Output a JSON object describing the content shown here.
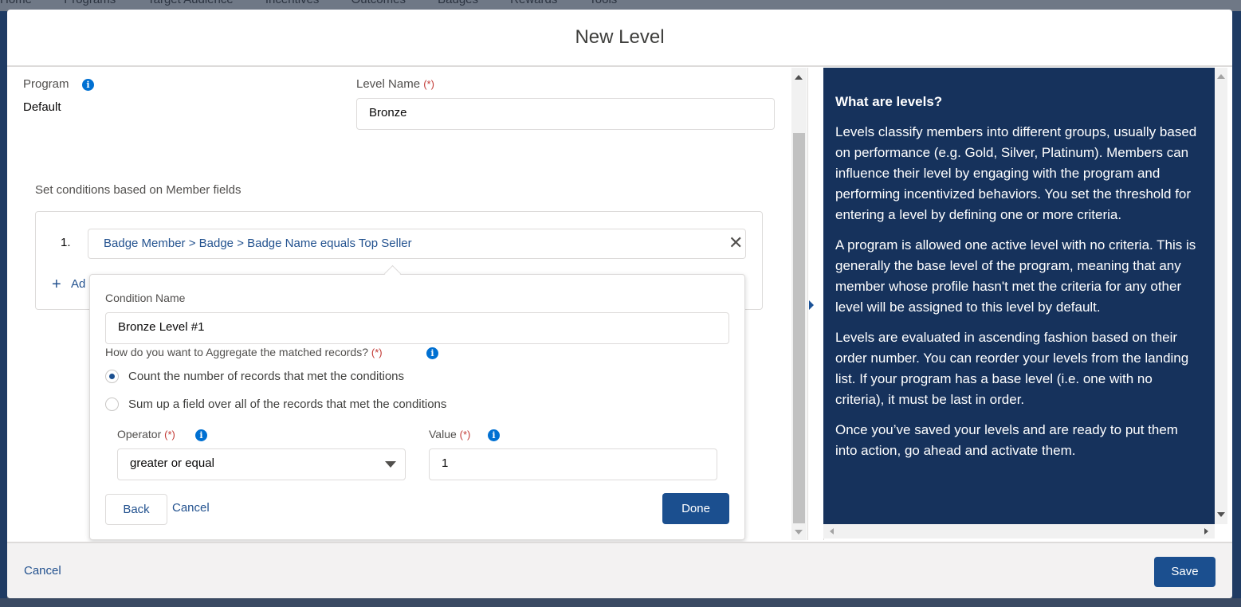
{
  "background_nav": {
    "items": [
      "Home",
      "Programs",
      "Target Audience",
      "Incentives",
      "Outcomes",
      "Badges",
      "Rewards",
      "Tools"
    ]
  },
  "modal": {
    "title": "New Level",
    "footer": {
      "cancel_label": "Cancel",
      "save_label": "Save"
    }
  },
  "program": {
    "label": "Program",
    "value": "Default"
  },
  "level_name": {
    "label": "Level Name",
    "required_marker": "(*)",
    "value": "Bronze"
  },
  "conditions": {
    "heading": "Set conditions based on Member fields",
    "items": [
      {
        "number": "1.",
        "text": "Badge Member > Badge > Badge Name equals Top Seller",
        "remove_icon": "close-icon"
      }
    ],
    "add_label": "Ad"
  },
  "popover": {
    "condition_name_label": "Condition Name",
    "condition_name_value": "Bronze Level #1",
    "aggregate_question": "How do you want to Aggregate the matched records?",
    "required_marker": "(*)",
    "options": [
      {
        "label": "Count the number of records that met the conditions",
        "selected": true
      },
      {
        "label": "Sum up a field over all of the records that met the conditions",
        "selected": false
      }
    ],
    "operator_label": "Operator",
    "operator_value": "greater or equal",
    "value_label": "Value",
    "value_value": "1",
    "back_label": "Back",
    "cancel_label": "Cancel",
    "done_label": "Done"
  },
  "help": {
    "title": "What are levels?",
    "paragraphs": [
      "Levels classify members into different groups, usually based on performance (e.g. Gold, Silver, Platinum). Members can influence their level by engaging with the program and performing incentivized behaviors. You set the threshold for entering a level by defining one or more criteria.",
      "A program is allowed one active level with no criteria. This is generally the base level of the program, meaning that any member whose profile hasn't met the criteria for any other level will be assigned to this level by default.",
      "Levels are evaluated in ascending fashion based on their order number. You can reorder your levels from the landing list. If your program has a base level (i.e. one with no criteria), it must be last in order.",
      "Once you’ve saved your levels and are ready to put them into action, go ahead and activate them."
    ]
  },
  "colors": {
    "brand": "#1b4f8f",
    "link": "#23528f",
    "required": "#c23934",
    "info": "#0070d2",
    "help_panel": "#16325c"
  },
  "icons": {
    "info": "info-icon",
    "close": "close-icon",
    "add": "plus-icon",
    "dropdown": "chevron-down-icon"
  }
}
